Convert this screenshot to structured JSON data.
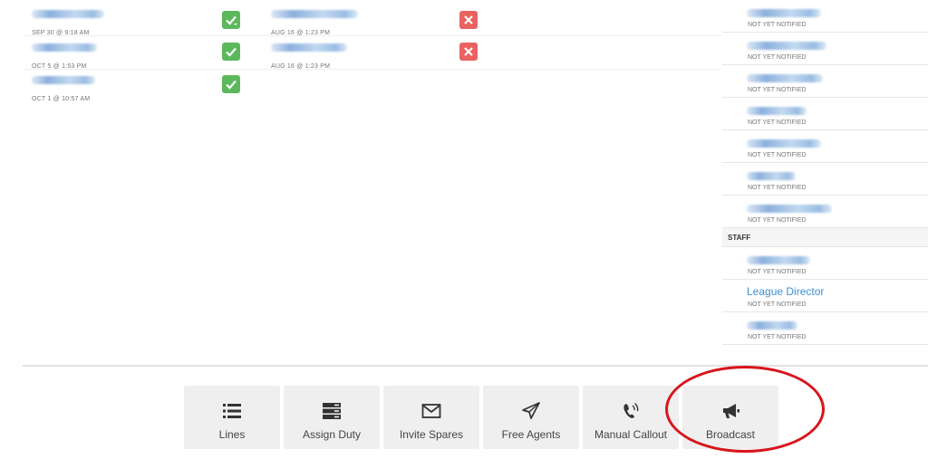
{
  "left_rows": [
    {
      "a_time": "SEP 30 @ 9:18 AM",
      "a_status": "confirmed",
      "b_time": "AUG 16 @ 1:23 PM",
      "b_status": "declined"
    },
    {
      "a_time": "OCT 5 @ 1:53 PM",
      "a_status": "confirmed",
      "b_time": "AUG 16 @ 1:23 PM",
      "b_status": "declined"
    },
    {
      "a_time": "OCT 1 @ 10:57 AM",
      "a_status": "confirmed"
    }
  ],
  "right_panel": {
    "players": [
      {
        "status": "NOT YET NOTIFIED"
      },
      {
        "status": "NOT YET NOTIFIED"
      },
      {
        "status": "NOT YET NOTIFIED"
      },
      {
        "status": "NOT YET NOTIFIED"
      },
      {
        "status": "NOT YET NOTIFIED"
      },
      {
        "status": "NOT YET NOTIFIED"
      },
      {
        "status": "NOT YET NOTIFIED"
      }
    ],
    "staff_header": "STAFF",
    "staff": [
      {
        "status": "NOT YET NOTIFIED"
      },
      {
        "name": "League Director",
        "status": "NOT YET NOTIFIED"
      },
      {
        "status": "NOT YET NOTIFIED"
      }
    ]
  },
  "toolbar": {
    "lines": "Lines",
    "assign_duty": "Assign Duty",
    "invite_spares": "Invite Spares",
    "free_agents": "Free Agents",
    "manual_callout": "Manual Callout",
    "broadcast": "Broadcast"
  },
  "colors": {
    "confirm": "#5cb85c",
    "decline": "#e8625f",
    "link": "#3e8fcf",
    "annotation": "#d8141c"
  },
  "icons": {
    "confirm": "check-icon",
    "decline": "x-icon",
    "lines": "list-icon",
    "assign_duty": "server-icon",
    "invite_spares": "envelope-icon",
    "free_agents": "paper-plane-icon",
    "manual_callout": "phone-icon",
    "broadcast": "megaphone-icon"
  }
}
